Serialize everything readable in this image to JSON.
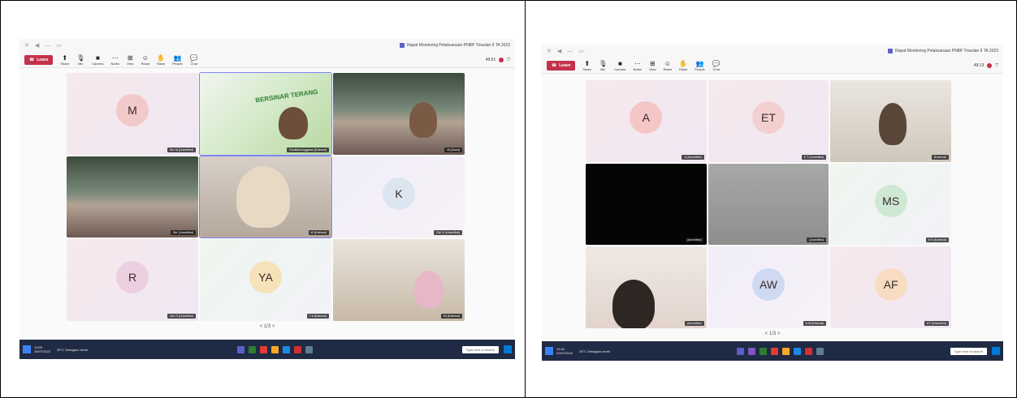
{
  "left": {
    "window_title": "Rapat Monitoring Pelaksanaan PNBP Triwulan II TA 2023",
    "toolbar": {
      "leave_label": "Leave",
      "items": [
        "Chat",
        "People",
        "Raise",
        "React",
        "View",
        "Notes",
        "Camera",
        "Mic",
        "Share"
      ],
      "timer": "49:51"
    },
    "tiles": [
      {
        "avatar": "M",
        "name": "Sdr. M (Unverified)"
      },
      {
        "avatar": "",
        "name": "Pusdiklat Anggaran (External)",
        "banner": "BERSINAR TERANG"
      },
      {
        "avatar": "",
        "name": "M (Guest)"
      },
      {
        "avatar": "",
        "name": "Sdr. (Unverified)"
      },
      {
        "avatar": "",
        "name": "W (External)"
      },
      {
        "avatar": "K",
        "name": "Sdr. K (Unverified)"
      },
      {
        "avatar": "R",
        "name": "Sdr. R (Unverified)"
      },
      {
        "avatar": "YA",
        "name": "Y A (External)"
      },
      {
        "avatar": "",
        "name": "Sri (External)"
      }
    ],
    "pager": "< 1/3 >",
    "taskbar": {
      "time": "13:50",
      "date": "20/07/2023",
      "weather": "28°C Sebagian cerah",
      "search_placeholder": "Type here to search"
    }
  },
  "right": {
    "window_title": "Rapat Monitoring Pelaksanaan PNBP Triwulan II TA 2023",
    "toolbar": {
      "leave_label": "Leave",
      "items": [
        "Chat",
        "People",
        "Raise",
        "React",
        "View",
        "Notes",
        "Camera",
        "Mic",
        "Share"
      ],
      "timer": "49:13"
    },
    "tiles": [
      {
        "avatar": "A",
        "name": "A (Unverified)"
      },
      {
        "avatar": "ET",
        "name": "E T (Unverified)"
      },
      {
        "avatar": "",
        "name": "(External)"
      },
      {
        "avatar": "",
        "name": "(Unverified)"
      },
      {
        "avatar": "",
        "name": "(Unverified)"
      },
      {
        "avatar": "MS",
        "name": "M S (External)"
      },
      {
        "avatar": "",
        "name": "(Unverified)"
      },
      {
        "avatar": "AW",
        "name": "A W (External)"
      },
      {
        "avatar": "AF",
        "name": "A F (Unverified)"
      }
    ],
    "pager": "< 1/3 >",
    "taskbar": {
      "time": "13:40",
      "date": "20/07/2023",
      "weather": "28°C Sebagian cerah",
      "search_placeholder": "Type here to search"
    }
  }
}
